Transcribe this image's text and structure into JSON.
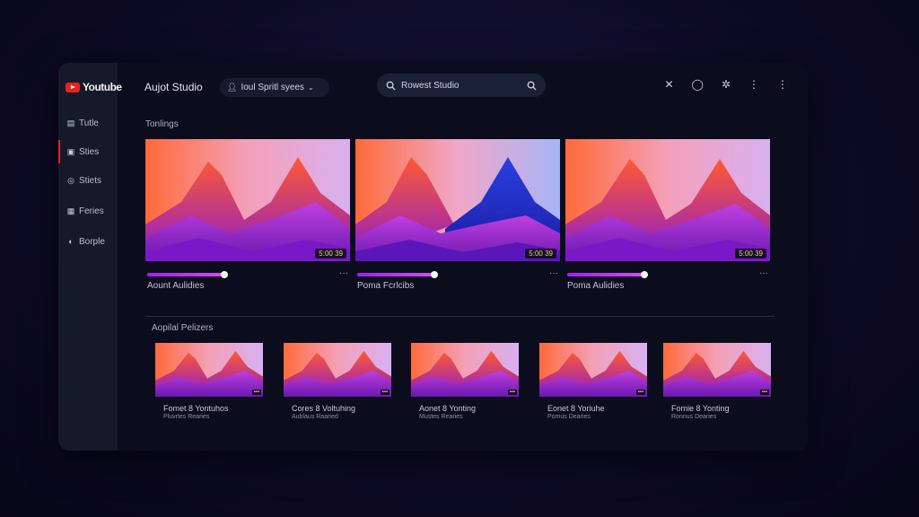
{
  "app": {
    "logo_text": "Youtube",
    "title": "Aujot Studio"
  },
  "channel_selector": {
    "label": "Ioul Spritl syees",
    "chevron": "chevron-down-icon"
  },
  "search": {
    "value": "Rowest Studio"
  },
  "sidebar": {
    "items": [
      {
        "label": "Tutle",
        "icon": "dashboard-icon",
        "active": false
      },
      {
        "label": "Sties",
        "icon": "content-icon",
        "active": true
      },
      {
        "label": "Stiets",
        "icon": "analytics-icon",
        "active": false
      },
      {
        "label": "Feries",
        "icon": "playlist-icon",
        "active": false
      },
      {
        "label": "Borple",
        "icon": "audience-icon",
        "active": false
      }
    ]
  },
  "top_icons": [
    "cut-icon",
    "notification-icon",
    "settings-icon",
    "more-icon",
    "more-icon"
  ],
  "featured": {
    "label": "Tonlings",
    "videos": [
      {
        "title": "Aount Aulidies",
        "duration": "5:00 39",
        "progress": 0.42,
        "variant": "orange"
      },
      {
        "title": "Poma Fcrlcibs",
        "duration": "5:00 39",
        "progress": 0.42,
        "variant": "blue"
      },
      {
        "title": "Poma Aulidies",
        "duration": "5:00 39",
        "progress": 0.42,
        "variant": "orange"
      }
    ]
  },
  "playlists": {
    "label": "Aopilal Pelizers",
    "items": [
      {
        "title": "Fomet 8 Yontuhos",
        "subtitle": "Pluvrtes Rearies"
      },
      {
        "title": "Cores 8 Voltuhing",
        "subtitle": "Aublaus Raaried"
      },
      {
        "title": "Aonet 8 Yonting",
        "subtitle": "Mustes Rearies"
      },
      {
        "title": "Eonet 8 Yoriuhe",
        "subtitle": "Pomus Dearies"
      },
      {
        "title": "Fomie 8 Yonting",
        "subtitle": "Ronnus Dearies"
      }
    ]
  },
  "colors": {
    "accent": "#e8231f",
    "progress": "#a020f0",
    "background": "#0b0d1c",
    "sidebar": "#151a2b"
  }
}
